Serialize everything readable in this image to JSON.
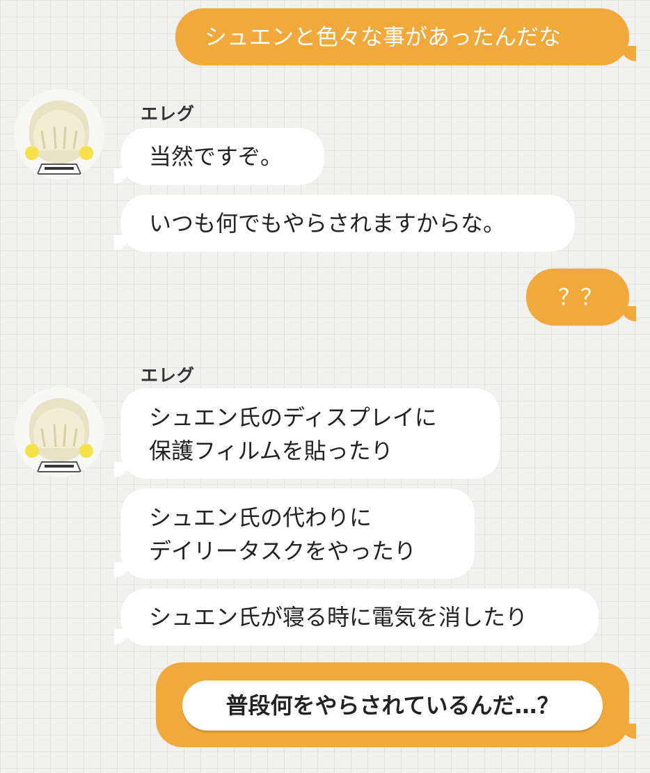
{
  "messages": {
    "m1": "シュエンと色々な事があったんだな",
    "sender1": "エレグ",
    "m2": "当然ですぞ。",
    "m3": "いつも何でもやらされますからな。",
    "m4": "？？",
    "sender2": "エレグ",
    "m5_line1": "シュエン氏のディスプレイに",
    "m5_line2": "保護フィルムを貼ったり",
    "m6_line1": "シュエン氏の代わりに",
    "m6_line2": "デイリータスクをやったり",
    "m7": "シュエン氏が寝る時に電気を消したり"
  },
  "reply_choice": {
    "label": "普段何をやらされているんだ…？"
  },
  "avatar": {
    "icon": "character-avatar-icon"
  },
  "colors": {
    "outgoing_bubble": "#f2a93b",
    "incoming_bubble": "#ffffff",
    "background": "#f1f1f0"
  }
}
